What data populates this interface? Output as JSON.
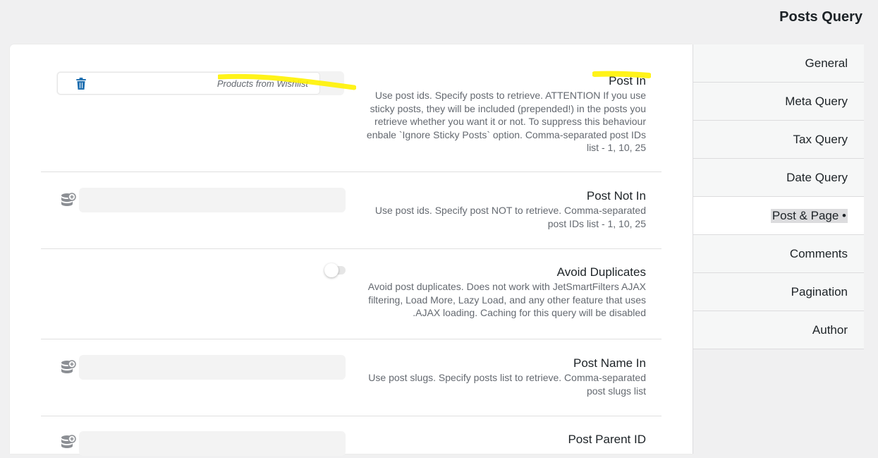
{
  "header": {
    "title": "Posts Query"
  },
  "tabs": [
    {
      "label": "General"
    },
    {
      "label": "Meta Query"
    },
    {
      "label": "Tax Query"
    },
    {
      "label": "Date Query"
    },
    {
      "label": "Post & Page •",
      "active": true
    },
    {
      "label": "Comments"
    },
    {
      "label": "Pagination"
    },
    {
      "label": "Author"
    }
  ],
  "fields": {
    "post_in": {
      "title": "Post In",
      "tag": "Products from Wishlist",
      "desc": "Use post ids. Specify posts to retrieve. ATTENTION If you use sticky posts, they will be included (prepended!) in the posts you retrieve whether you want it or not. To suppress this behaviour enbale `Ignore Sticky Posts` option. Comma-separated post IDs list - 1, 10, 25"
    },
    "post_not_in": {
      "title": "Post Not In",
      "desc": "Use post ids. Specify post NOT to retrieve. Comma-separated post IDs list - 1, 10, 25"
    },
    "avoid_duplicates": {
      "title": "Avoid Duplicates",
      "desc": "Avoid post duplicates. Does not work with JetSmartFilters AJAX filtering, Load More, Lazy Load, and any other feature that uses AJAX loading. Caching for this query will be disabled.",
      "enabled": false
    },
    "post_name_in": {
      "title": "Post Name In",
      "desc": "Use post slugs. Specify posts list to retrieve. Comma-separated post slugs list"
    },
    "post_parent_id": {
      "title": "Post Parent ID"
    }
  },
  "colors": {
    "highlight": "#fff200",
    "icon_blue": "#2271b1",
    "db_icon": "#8c8f94"
  },
  "icons": {
    "trash": "trash-icon",
    "database_add": "database-add-icon"
  }
}
